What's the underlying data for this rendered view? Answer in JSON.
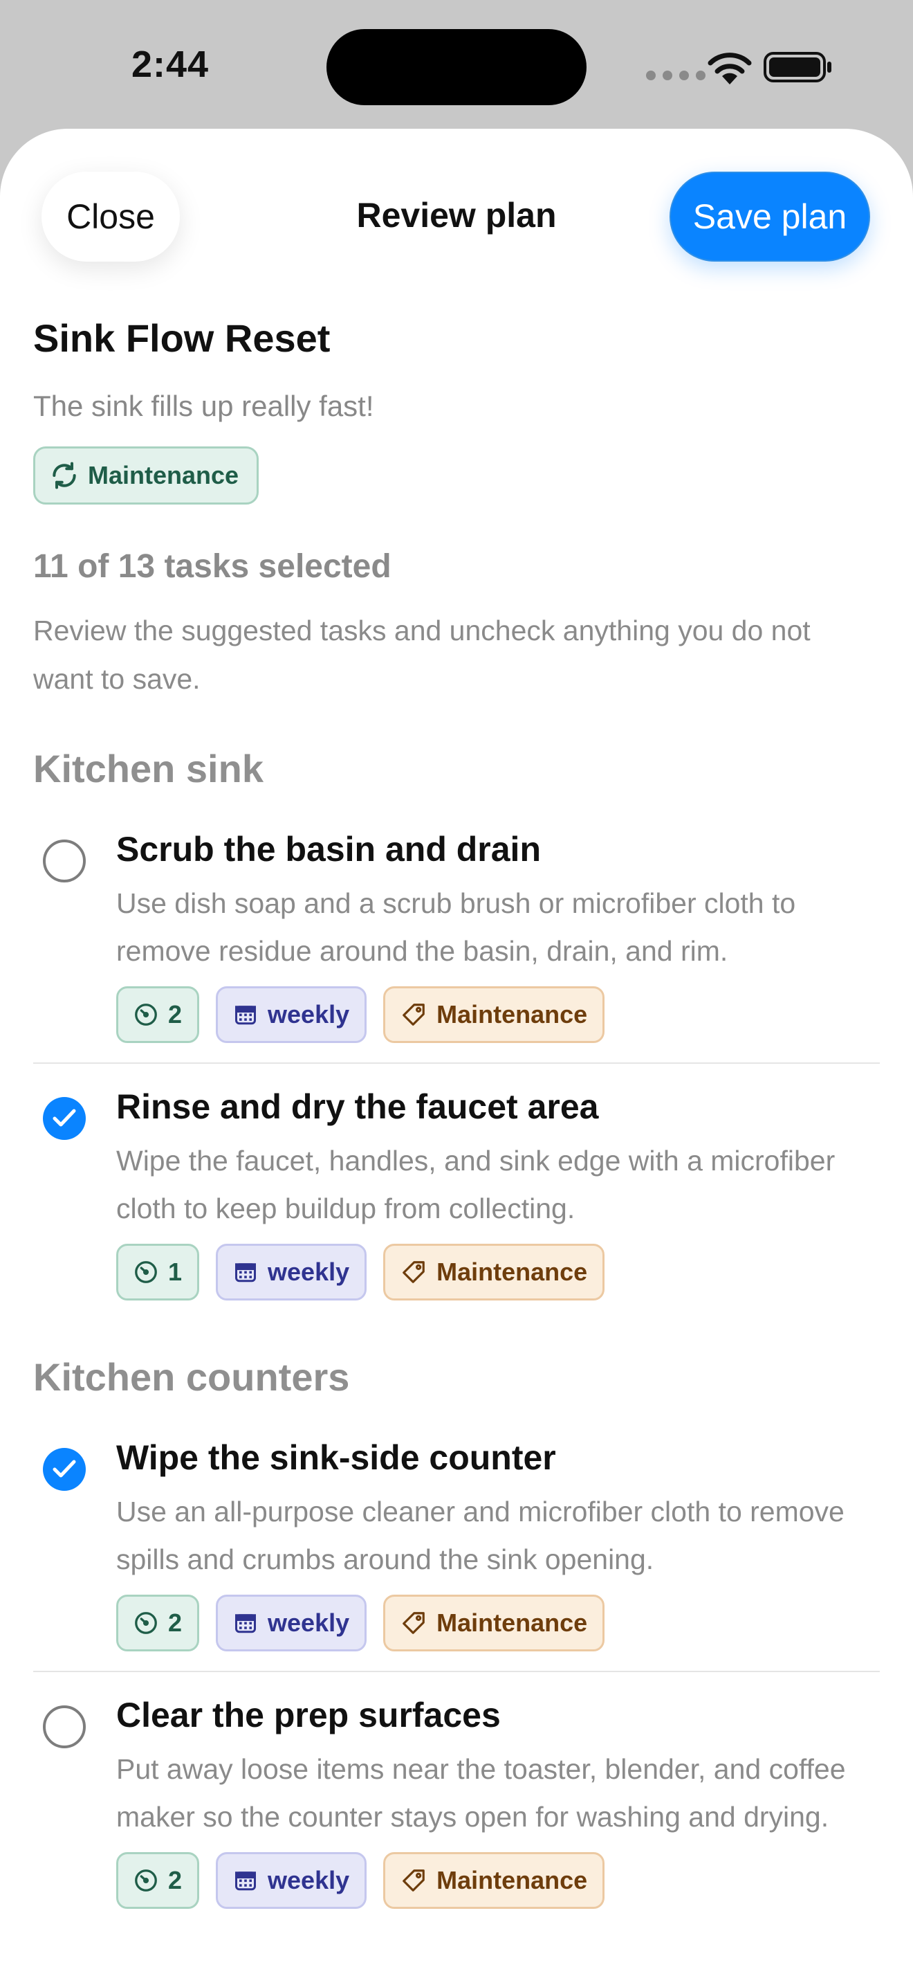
{
  "status_bar": {
    "time": "2:44"
  },
  "header": {
    "close_label": "Close",
    "title": "Review plan",
    "save_label": "Save plan"
  },
  "plan": {
    "name": "Sink Flow Reset",
    "description": "The sink fills up really fast!",
    "category": "Maintenance",
    "selection_summary": "11 of 13 tasks selected",
    "instructions": "Review the suggested tasks and uncheck anything you do not want to save."
  },
  "sections": [
    {
      "title": "Kitchen sink",
      "tasks": [
        {
          "title": "Scrub the basin and drain",
          "description": "Use dish soap and a scrub brush or microfiber cloth to remove residue around the basin, drain, and rim.",
          "checked": false,
          "effort": "2",
          "frequency": "weekly",
          "tag": "Maintenance"
        },
        {
          "title": "Rinse and dry the faucet area",
          "description": "Wipe the faucet, handles, and sink edge with a microfiber cloth to keep buildup from collecting.",
          "checked": true,
          "effort": "1",
          "frequency": "weekly",
          "tag": "Maintenance"
        }
      ]
    },
    {
      "title": "Kitchen counters",
      "tasks": [
        {
          "title": "Wipe the sink-side counter",
          "description": "Use an all-purpose cleaner and microfiber cloth to remove spills and crumbs around the sink opening.",
          "checked": true,
          "effort": "2",
          "frequency": "weekly",
          "tag": "Maintenance"
        },
        {
          "title": "Clear the prep surfaces",
          "description": "Put away loose items near the toaster, blender, and coffee maker so the counter stays open for washing and drying.",
          "checked": false,
          "effort": "2",
          "frequency": "weekly",
          "tag": "Maintenance"
        }
      ]
    }
  ],
  "colors": {
    "accent": "#0a84ff",
    "effort_chip": "#e3f2ec",
    "frequency_chip": "#e6e7f8",
    "tag_chip": "#fbeedd"
  }
}
